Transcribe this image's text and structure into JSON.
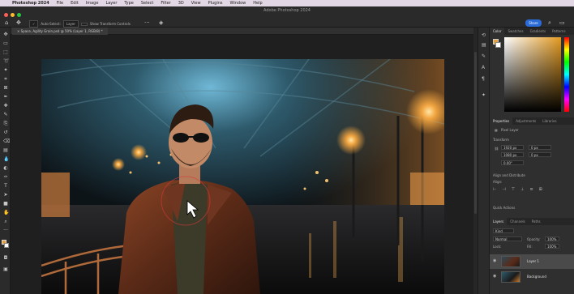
{
  "menubar": {
    "apple": "",
    "app": "Photoshop 2024",
    "items": [
      "File",
      "Edit",
      "Image",
      "Layer",
      "Type",
      "Select",
      "Filter",
      "3D",
      "View",
      "Plugins",
      "Window",
      "Help"
    ]
  },
  "window": {
    "title": "Adobe Photoshop 2024",
    "dot_colors": [
      "#ff5f57",
      "#febc2e",
      "#28c840"
    ]
  },
  "options": {
    "mode": "Auto-Select:",
    "mode_value": "Layer",
    "transform": "Show Transform Controls",
    "more": "···",
    "share": "Share"
  },
  "document": {
    "tab": "Space, Agility Grain.psd @ 50% (Layer 1, RGB/8) *"
  },
  "colors": {
    "brand_blue": "#2a6bd8",
    "foreground": "#e6a03a",
    "background": "#ffffff"
  },
  "color_panel": {
    "tabs": [
      "Color",
      "Swatches",
      "Gradients",
      "Patterns"
    ],
    "active": 0
  },
  "properties_panel": {
    "tabs": [
      "Properties",
      "Adjustments",
      "Libraries"
    ],
    "active": 0,
    "layer_type": "Pixel Layer",
    "transform_label": "Transform",
    "w": "1920 px",
    "h": "1080 px",
    "x": "0 px",
    "y": "0 px",
    "angle": "0.00°",
    "align_label": "Align and Distribute",
    "align_sub": "Align:",
    "quick_actions": "Quick Actions"
  },
  "layers_panel": {
    "tabs": [
      "Layers",
      "Channels",
      "Paths"
    ],
    "active": 0,
    "kind": "Kind",
    "blend": "Normal",
    "opacity_label": "Opacity:",
    "opacity": "100%",
    "lock_label": "Lock:",
    "fill_label": "Fill:",
    "fill": "100%",
    "layers": [
      {
        "name": "Layer 1",
        "selected": true
      },
      {
        "name": "Background",
        "selected": false
      }
    ]
  },
  "tools": [
    "move-tool",
    "artboard-tool",
    "marquee-tool",
    "lasso-tool",
    "quick-select-tool",
    "crop-tool",
    "frame-tool",
    "eyedropper-tool",
    "healing-tool",
    "brush-tool",
    "clone-stamp-tool",
    "history-brush-tool",
    "eraser-tool",
    "gradient-tool",
    "blur-tool",
    "dodge-tool",
    "pen-tool",
    "type-tool",
    "path-select-tool",
    "rectangle-tool",
    "hand-tool",
    "zoom-tool",
    "more-tools"
  ]
}
